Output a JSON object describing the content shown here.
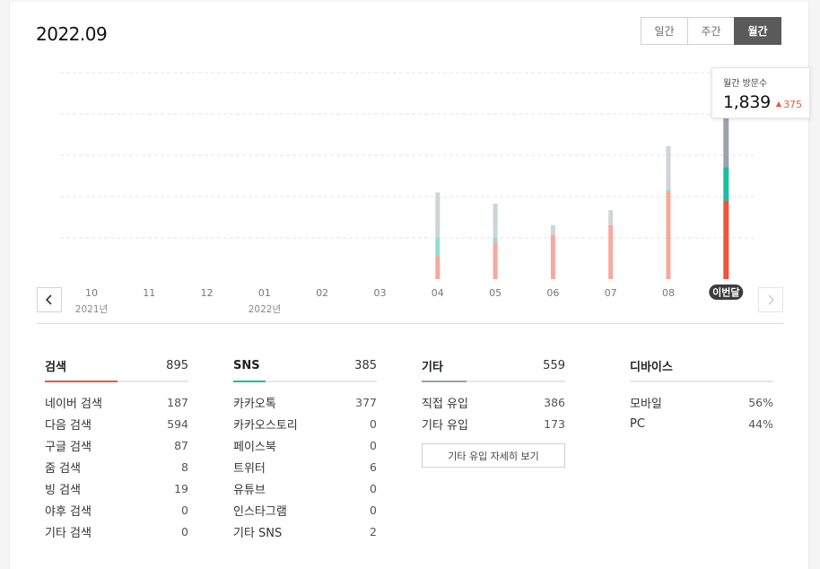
{
  "header": {
    "period": "2022.09"
  },
  "tabs": [
    {
      "label": "일간",
      "active": false
    },
    {
      "label": "주간",
      "active": false
    },
    {
      "label": "월간",
      "active": true
    }
  ],
  "tooltip": {
    "label": "월간 방문수",
    "value": "1,839",
    "delta": "375",
    "delta_color": "#f0533c"
  },
  "chart_data": {
    "type": "bar",
    "stacked": true,
    "categories": [
      "10",
      "11",
      "12",
      "01",
      "02",
      "03",
      "04",
      "05",
      "06",
      "07",
      "08",
      "이번달"
    ],
    "year_labels": [
      {
        "category_index": 0,
        "text": "2021년"
      },
      {
        "category_index": 3,
        "text": "2022년"
      }
    ],
    "highlight_index": 11,
    "series": [
      {
        "name": "검색",
        "color_current": "#f0533c",
        "color_past": "#f7a99c",
        "values": [
          0,
          0,
          0,
          0,
          0,
          0,
          560,
          900,
          1080,
          1310,
          2130,
          1900
        ]
      },
      {
        "name": "SNS",
        "color_current": "#18bfa3",
        "color_past": "#8fdfd1",
        "values": [
          0,
          0,
          0,
          0,
          0,
          0,
          450,
          100,
          0,
          0,
          40,
          815
        ]
      },
      {
        "name": "기타",
        "color_current": "#9aa3ad",
        "color_past": "#cfd4d9",
        "values": [
          0,
          0,
          0,
          0,
          0,
          0,
          1090,
          830,
          230,
          360,
          1050,
          1180
        ]
      }
    ],
    "ylim": [
      0,
      5000
    ],
    "gridlines": 5,
    "grid": true
  },
  "breakdown": [
    {
      "title": "검색",
      "total": "895",
      "accent": "#f0533c",
      "rows": [
        {
          "label": "네이버 검색",
          "value": "187"
        },
        {
          "label": "다음 검색",
          "value": "594"
        },
        {
          "label": "구글 검색",
          "value": "87"
        },
        {
          "label": "줌 검색",
          "value": "8"
        },
        {
          "label": "빙 검색",
          "value": "19"
        },
        {
          "label": "야후 검색",
          "value": "0"
        },
        {
          "label": "기타 검색",
          "value": "0"
        }
      ]
    },
    {
      "title": "SNS",
      "total": "385",
      "accent": "#18bfa3",
      "rows": [
        {
          "label": "카카오톡",
          "value": "377"
        },
        {
          "label": "카카오스토리",
          "value": "0"
        },
        {
          "label": "페이스북",
          "value": "0"
        },
        {
          "label": "트위터",
          "value": "6"
        },
        {
          "label": "유튜브",
          "value": "0"
        },
        {
          "label": "인스타그램",
          "value": "0"
        },
        {
          "label": "기타 SNS",
          "value": "2"
        }
      ]
    },
    {
      "title": "기타",
      "total": "559",
      "accent": "#9aa3ad",
      "rows": [
        {
          "label": "직접 유입",
          "value": "386"
        },
        {
          "label": "기타 유입",
          "value": "173"
        }
      ],
      "button": "기타 유입 자세히 보기"
    },
    {
      "title": "디바이스",
      "total": "",
      "accent": "",
      "rows": [
        {
          "label": "모바일",
          "value": "56%"
        },
        {
          "label": "PC",
          "value": "44%"
        }
      ]
    }
  ]
}
